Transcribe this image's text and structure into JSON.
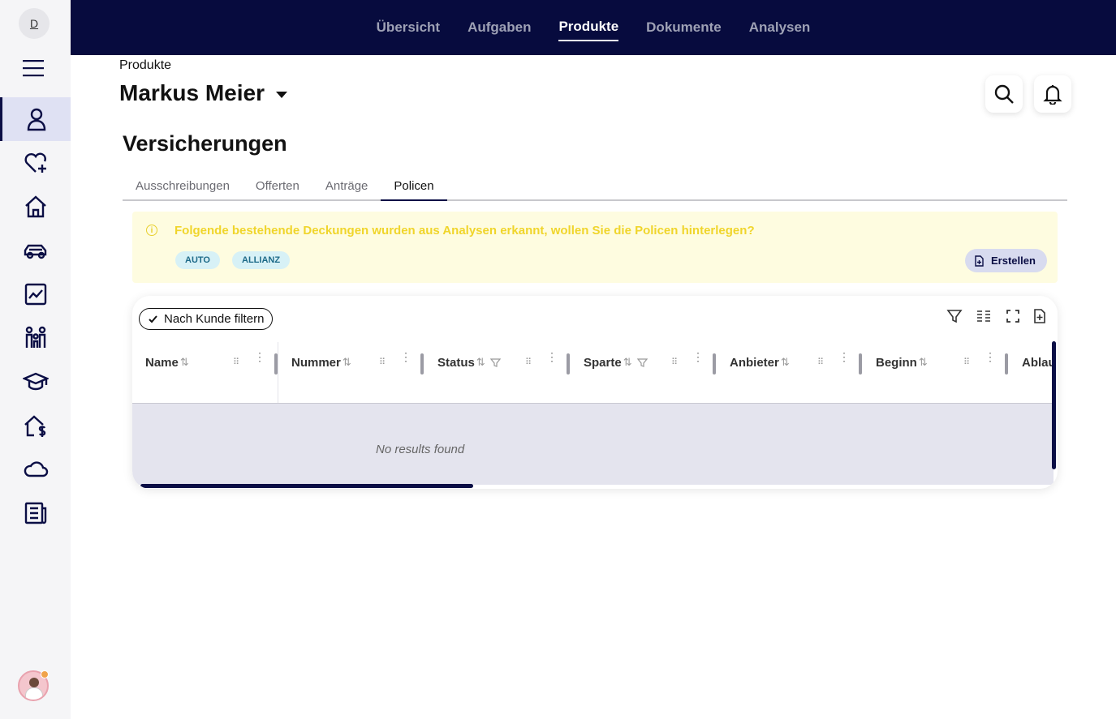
{
  "sidebar": {
    "org_initial": "D",
    "items": [
      {
        "icon": "user-icon"
      },
      {
        "icon": "heart-plus-icon"
      },
      {
        "icon": "home-icon"
      },
      {
        "icon": "car-icon"
      },
      {
        "icon": "chart-icon"
      },
      {
        "icon": "family-icon"
      },
      {
        "icon": "graduation-cap-icon"
      },
      {
        "icon": "house-dollar-icon"
      },
      {
        "icon": "cloud-icon"
      },
      {
        "icon": "document-list-icon"
      }
    ]
  },
  "topnav": {
    "items": [
      "Übersicht",
      "Aufgaben",
      "Produkte",
      "Dokumente",
      "Analysen"
    ],
    "active": "Produkte"
  },
  "header": {
    "breadcrumb": "Produkte",
    "customer_name": "Markus Meier"
  },
  "section": {
    "title": "Versicherungen",
    "tabs": [
      "Ausschreibungen",
      "Offerten",
      "Anträge",
      "Policen"
    ],
    "active_tab": "Policen"
  },
  "banner": {
    "message": "Folgende bestehende Deckungen wurden aus Analysen erkannt, wollen Sie die Policen hinterlegen?",
    "chips": [
      "AUTO",
      "ALLIANZ"
    ],
    "create_label": "Erstellen"
  },
  "table": {
    "filter_chip": "Nach Kunde filtern",
    "columns": [
      "Name",
      "Nummer",
      "Status",
      "Sparte",
      "Anbieter",
      "Beginn",
      "Ablau"
    ],
    "empty_text": "No results found"
  },
  "colors": {
    "navy": "#070b3e",
    "banner_bg": "#fefce0",
    "banner_text": "#f0d52b"
  }
}
